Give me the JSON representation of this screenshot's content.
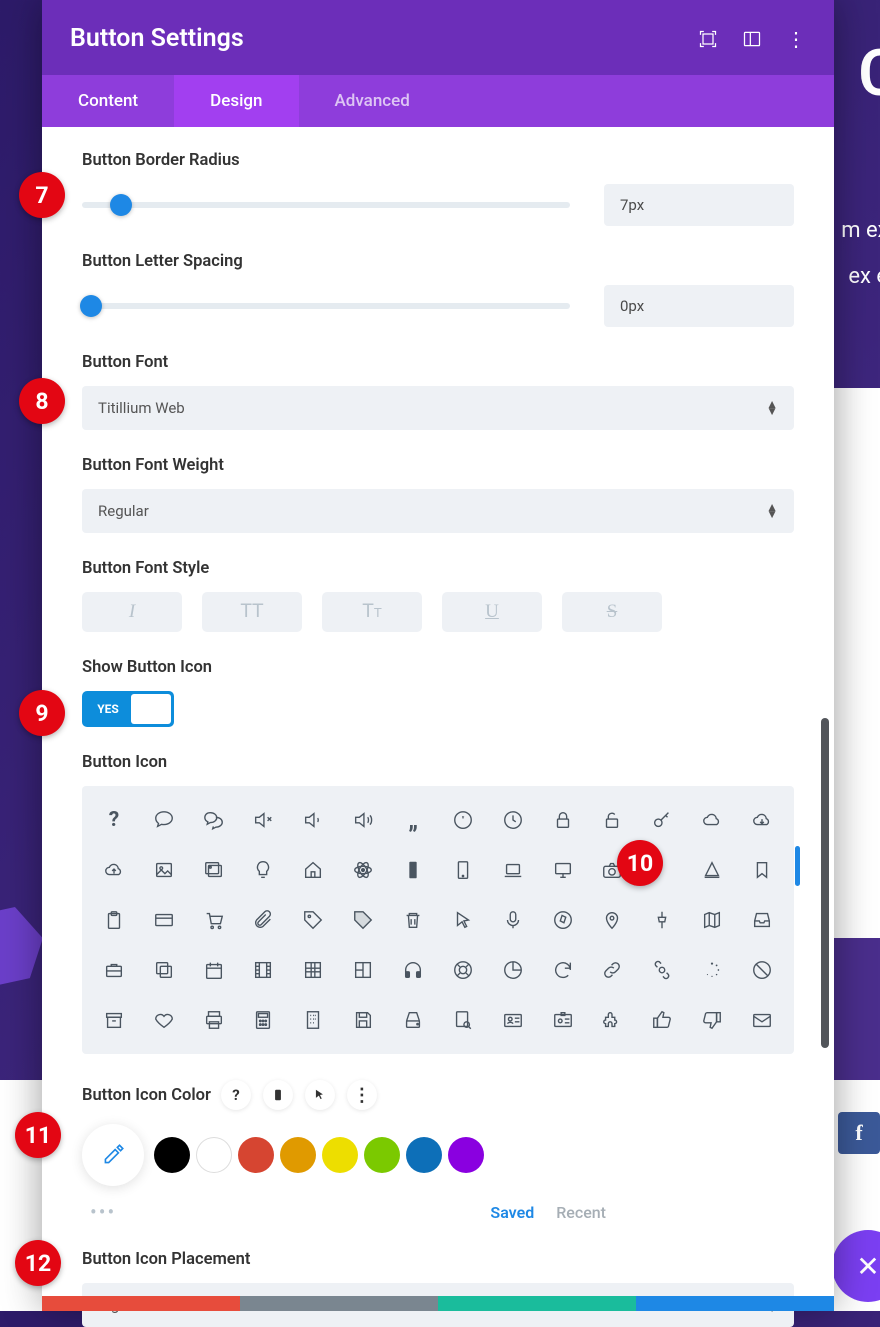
{
  "header": {
    "title": "Button Settings"
  },
  "tabs": {
    "content": "Content",
    "design": "Design",
    "advanced": "Advanced"
  },
  "fields": {
    "border_radius_label": "Button Border Radius",
    "border_radius_value": "7px",
    "letter_spacing_label": "Button Letter Spacing",
    "letter_spacing_value": "0px",
    "font_label": "Button Font",
    "font_value": "Titillium Web",
    "font_weight_label": "Button Font Weight",
    "font_weight_value": "Regular",
    "font_style_label": "Button Font Style",
    "show_icon_label": "Show Button Icon",
    "toggle_text": "YES",
    "button_icon_label": "Button Icon",
    "icon_color_label": "Button Icon Color",
    "icon_placement_label": "Button Icon Placement",
    "icon_placement_value": "Right",
    "saved": "Saved",
    "recent": "Recent"
  },
  "colors": {
    "swatches": [
      "#000000",
      "#ffffff",
      "#d64531",
      "#e09a00",
      "#edde00",
      "#7bc900",
      "#0d6fb8",
      "#8a00e0"
    ]
  },
  "bg": {
    "big_c": "C",
    "line1": "m exe",
    "line2": "ex ea"
  },
  "callouts": {
    "c7": "7",
    "c8": "8",
    "c9": "9",
    "c10": "10",
    "c11": "11",
    "c12": "12"
  }
}
